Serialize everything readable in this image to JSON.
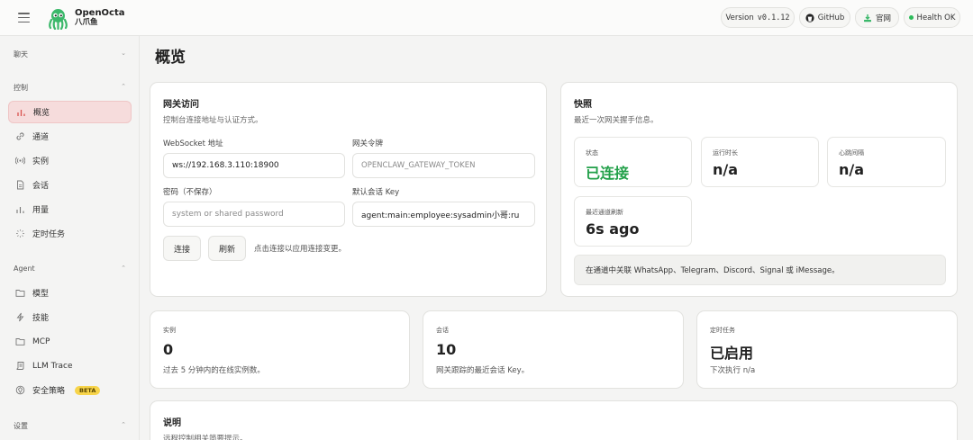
{
  "app": {
    "name": "OpenOcta",
    "subtitle": "八爪鱼"
  },
  "topbar": {
    "version_label": "Version",
    "version": "v0.1.12",
    "github": "GitHub",
    "website": "官网",
    "health": "Health OK",
    "health_color": "#2dbb5a"
  },
  "sidebar": {
    "chat_section": "聊天",
    "control_section": "控制",
    "control_items": [
      {
        "label": "概览",
        "icon": "bar-chart-icon"
      },
      {
        "label": "通道",
        "icon": "link-icon"
      },
      {
        "label": "实例",
        "icon": "broadcast-icon"
      },
      {
        "label": "会话",
        "icon": "document-icon"
      },
      {
        "label": "用量",
        "icon": "bar-chart-icon"
      },
      {
        "label": "定时任务",
        "icon": "loader-icon"
      }
    ],
    "agent_section": "Agent",
    "agent_items": [
      {
        "label": "模型",
        "icon": "folder-icon"
      },
      {
        "label": "技能",
        "icon": "lightning-icon"
      },
      {
        "label": "MCP",
        "icon": "folder-icon"
      },
      {
        "label": "LLM Trace",
        "icon": "scroll-icon"
      },
      {
        "label": "安全策略",
        "icon": "shield-icon",
        "badge": "BETA"
      }
    ],
    "settings_section": "设置",
    "accent_color": "#f6dcdc"
  },
  "main": {
    "title": "概览",
    "gateway": {
      "title": "网关访问",
      "subtitle": "控制台连接地址与认证方式。",
      "ws_label": "WebSocket 地址",
      "ws_value": "ws://192.168.3.110:18900",
      "token_label": "网关令牌",
      "token_placeholder": "OPENCLAW_GATEWAY_TOKEN",
      "password_label": "密码（不保存）",
      "password_placeholder": "system or shared password",
      "session_label": "默认会话 Key",
      "session_value": "agent:main:employee:sysadmin小哥:ru",
      "connect_button": "连接",
      "refresh_button": "刷新",
      "hint": "点击连接以应用连接变更。"
    },
    "snapshot": {
      "title": "快照",
      "subtitle": "最近一次网关握手信息。",
      "status_label": "状态",
      "status_value": "已连接",
      "status_color": "#22a049",
      "uptime_label": "运行时长",
      "uptime_value": "n/a",
      "heartbeat_label": "心跳间隔",
      "heartbeat_value": "n/a",
      "refresh_label": "最近通道刷新",
      "refresh_value": "6s ago",
      "notice": "在通道中关联 WhatsApp、Telegram、Discord、Signal 或 iMessage。"
    },
    "bottom_cards": [
      {
        "label": "实例",
        "value": "0",
        "sub": "过去 5 分钟内的在线实例数。"
      },
      {
        "label": "会话",
        "value": "10",
        "sub": "网关跟踪的最近会话 Key。"
      },
      {
        "label": "定时任务",
        "value": "已启用",
        "sub": "下次执行 n/a"
      }
    ],
    "notes": {
      "title": "说明",
      "subtitle": "远程控制相关简要提示。"
    }
  }
}
